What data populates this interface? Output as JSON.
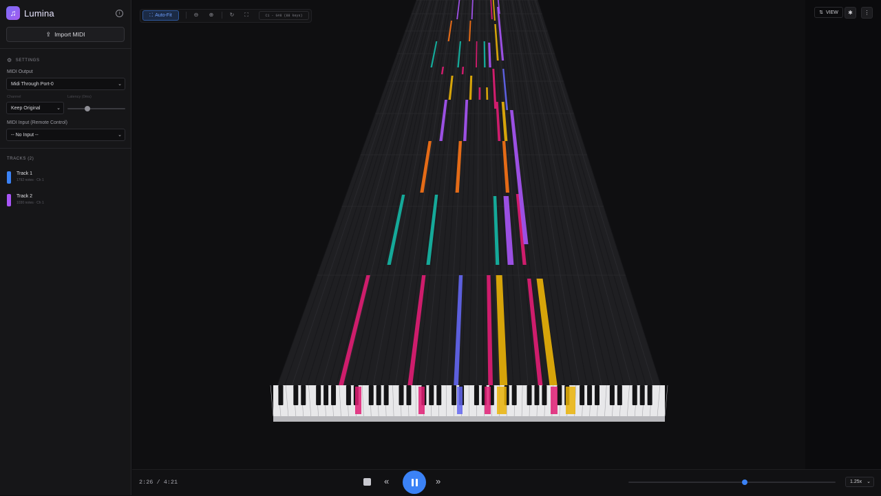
{
  "app": {
    "title": "Lumina"
  },
  "sidebar": {
    "import_label": "Import MIDI",
    "settings_heading": "SETTINGS",
    "midi_output_label": "MIDI Output",
    "midi_output_value": "Midi Through Port-0",
    "channel_label": "Channel",
    "channel_value": "Keep Original",
    "latency_label": "Latency (0ms)",
    "latency_value_ms": 0,
    "midi_input_label": "MIDI Input (Remote Control)",
    "midi_input_value": "-- No Input --",
    "tracks_heading": "TRACKS (2)",
    "tracks": [
      {
        "name": "Track 1",
        "meta": "1792 notes · Ch 1",
        "color": "#3b82f6"
      },
      {
        "name": "Track 2",
        "meta": "1030 notes · Ch 1",
        "color": "#a855f7"
      }
    ]
  },
  "toolbar": {
    "auto_fit_label": "Auto-Fit",
    "range_label": "C1 - G#8 (88 keys)",
    "icons": [
      "zoom-out-icon",
      "zoom-in-icon",
      "reset-icon",
      "fullscreen-icon"
    ]
  },
  "view": {
    "view_label": "VIEW"
  },
  "playback": {
    "time": "2:26 / 4:21",
    "progress": 0.56,
    "speed": "1.25x"
  },
  "colors": {
    "accent": "#3b82f6",
    "notes": [
      "#e11d74",
      "#eab308",
      "#a855f7",
      "#f97316",
      "#14b8a6",
      "#6366f1"
    ]
  }
}
